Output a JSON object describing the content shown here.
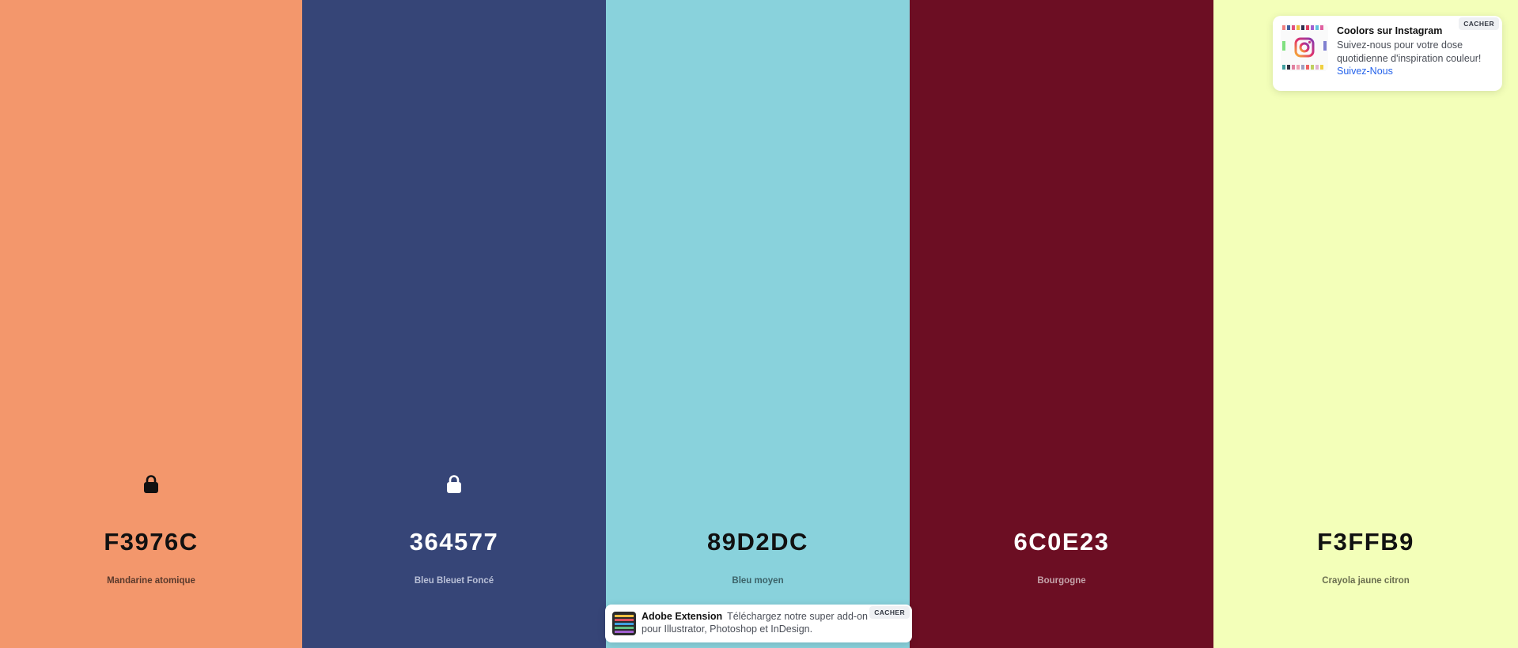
{
  "palette": {
    "colors": [
      {
        "hex": "F3976C",
        "name": "Mandarine atomique",
        "background": "#F3976C",
        "text_color": "#111111",
        "name_color": "#5a3a2c",
        "locked": true,
        "lock_color": "#111111"
      },
      {
        "hex": "364577",
        "name": "Bleu Bleuet Foncé",
        "background": "#364577",
        "text_color": "#ffffff",
        "name_color": "#b8bfd6",
        "locked": true,
        "lock_color": "#ffffff"
      },
      {
        "hex": "89D2DC",
        "name": "Bleu moyen",
        "background": "#89D2DC",
        "text_color": "#111111",
        "name_color": "#3c6369",
        "locked": false
      },
      {
        "hex": "6C0E23",
        "name": "Bourgogne",
        "background": "#6C0E23",
        "text_color": "#ffffff",
        "name_color": "#c4a3aa",
        "locked": false
      },
      {
        "hex": "F3FFB9",
        "name": "Crayola jaune citron",
        "background": "#F3FFB9",
        "text_color": "#111111",
        "name_color": "#6a6f50",
        "locked": false
      }
    ]
  },
  "instagram_popup": {
    "title": "Coolors sur Instagram",
    "text": "Suivez-nous pour votre dose quotidienne d'inspiration couleur!",
    "link": "Suivez-Nous",
    "hide_label": "CACHER",
    "link_color": "#2563eb",
    "icon": "instagram-icon"
  },
  "adobe_popup": {
    "title": "Adobe Extension",
    "text": "Téléchargez notre super add-on pour Illustrator, Photoshop et InDesign.",
    "hide_label": "CACHER",
    "icon": "adobe-extension-icon"
  }
}
